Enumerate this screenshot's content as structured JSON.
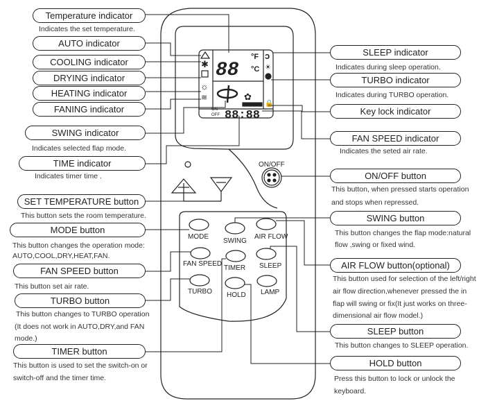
{
  "left_callouts": [
    {
      "label": "Temperature indicator",
      "desc": [
        "Indicates the set temperature."
      ]
    },
    {
      "label": "AUTO indicator",
      "desc": []
    },
    {
      "label": "COOLING indicator",
      "desc": []
    },
    {
      "label": "DRYING indicator",
      "desc": []
    },
    {
      "label": "HEATING indicator",
      "desc": []
    },
    {
      "label": "FANING indicator",
      "desc": []
    },
    {
      "label": "SWING indicator",
      "desc": [
        "Indicates selected flap mode."
      ]
    },
    {
      "label": "TIME indicator",
      "desc": [
        "Indicates timer time ."
      ]
    },
    {
      "label": "SET TEMPERATURE button",
      "desc": [
        "This button sets the room temperature."
      ]
    },
    {
      "label": "MODE button",
      "desc": [
        "This button changes  the operation mode:",
        "AUTO,COOL,DRY,HEAT,FAN."
      ]
    },
    {
      "label": "FAN SPEED  button",
      "desc": [
        "This button set air rate."
      ]
    },
    {
      "label": "TURBO  button",
      "desc": [
        "This button changes to TURBO operation",
        "(It does not work in AUTO,DRY,and FAN",
        "mode.)"
      ]
    },
    {
      "label": "TIMER  button",
      "desc": [
        "This button is used to set the switch-on or",
        "switch-off and the timer time."
      ]
    }
  ],
  "right_callouts": [
    {
      "label": "SLEEP indicator",
      "desc": [
        "Indicates during sleep operation."
      ]
    },
    {
      "label": "TURBO indicator",
      "desc": [
        "Indicates during TURBO operation."
      ]
    },
    {
      "label": "Key lock  indicator",
      "desc": []
    },
    {
      "label": "FAN SPEED  indicator",
      "desc": [
        "Indicates the seted air rate."
      ]
    },
    {
      "label": "ON/OFF button",
      "desc": [
        "This button, when pressed starts operation",
        "and stops when repressed."
      ]
    },
    {
      "label": "SWING button",
      "desc": [
        "This button changes the flap mode:natural",
        "flow  ,swing or fixed wind."
      ]
    },
    {
      "label": "AIR FLOW  button(optional)",
      "desc": [
        "This button used for selection of the left/right",
        "air flow direction,whenever pressed the in",
        "flap will swing or fix(It just works on three-",
        "dimensional air flow model.)"
      ]
    },
    {
      "label": "SLEEP button",
      "desc": [
        "This button changes to SLEEP operation."
      ]
    },
    {
      "label": "HOLD button",
      "desc": [
        "Press this button to lock or unlock the",
        "keyboard."
      ]
    }
  ],
  "remote": {
    "lcd": {
      "temp": "88",
      "unit_f": "°F",
      "unit_c": "°C",
      "time": "88:88",
      "timer_on": "ON",
      "timer_off": "OFF"
    },
    "onoff_label": "ON/OFF",
    "buttons": [
      "MODE",
      "SWING",
      "AIR FLOW",
      "FAN SPEED",
      "TIMER",
      "SLEEP",
      "TURBO",
      "HOLD",
      "LAMP"
    ],
    "icons": [
      "auto-icon",
      "cooling-icon",
      "drying-icon",
      "heating-icon",
      "faning-icon",
      "swing-icon",
      "sleep-icon",
      "lamp-icon",
      "turbo-icon",
      "fan-speed-icon",
      "lock-icon",
      "thermometer-icon",
      "plus-icon",
      "minus-icon"
    ]
  }
}
